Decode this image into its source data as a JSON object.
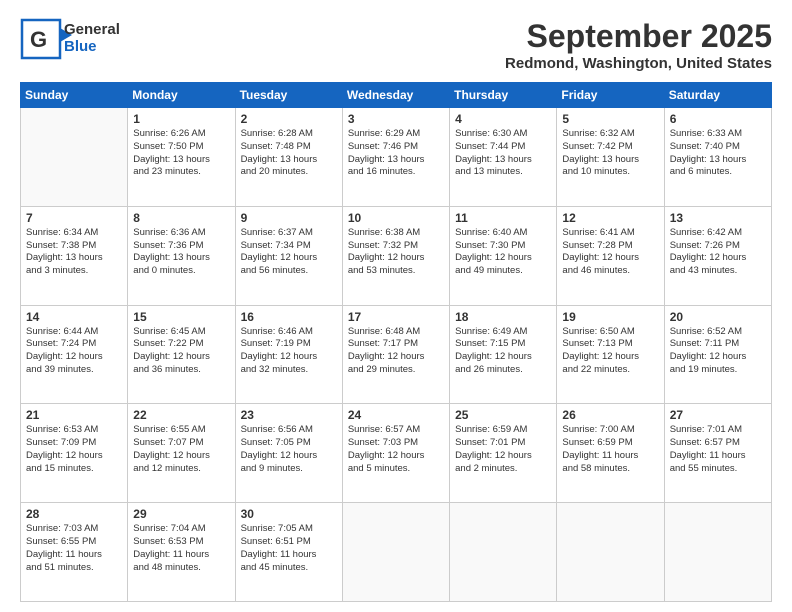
{
  "header": {
    "logo_general": "General",
    "logo_blue": "Blue",
    "month_title": "September 2025",
    "location": "Redmond, Washington, United States"
  },
  "calendar": {
    "days_of_week": [
      "Sunday",
      "Monday",
      "Tuesday",
      "Wednesday",
      "Thursday",
      "Friday",
      "Saturday"
    ],
    "weeks": [
      [
        {
          "day": "",
          "info": ""
        },
        {
          "day": "1",
          "info": "Sunrise: 6:26 AM\nSunset: 7:50 PM\nDaylight: 13 hours\nand 23 minutes."
        },
        {
          "day": "2",
          "info": "Sunrise: 6:28 AM\nSunset: 7:48 PM\nDaylight: 13 hours\nand 20 minutes."
        },
        {
          "day": "3",
          "info": "Sunrise: 6:29 AM\nSunset: 7:46 PM\nDaylight: 13 hours\nand 16 minutes."
        },
        {
          "day": "4",
          "info": "Sunrise: 6:30 AM\nSunset: 7:44 PM\nDaylight: 13 hours\nand 13 minutes."
        },
        {
          "day": "5",
          "info": "Sunrise: 6:32 AM\nSunset: 7:42 PM\nDaylight: 13 hours\nand 10 minutes."
        },
        {
          "day": "6",
          "info": "Sunrise: 6:33 AM\nSunset: 7:40 PM\nDaylight: 13 hours\nand 6 minutes."
        }
      ],
      [
        {
          "day": "7",
          "info": "Sunrise: 6:34 AM\nSunset: 7:38 PM\nDaylight: 13 hours\nand 3 minutes."
        },
        {
          "day": "8",
          "info": "Sunrise: 6:36 AM\nSunset: 7:36 PM\nDaylight: 13 hours\nand 0 minutes."
        },
        {
          "day": "9",
          "info": "Sunrise: 6:37 AM\nSunset: 7:34 PM\nDaylight: 12 hours\nand 56 minutes."
        },
        {
          "day": "10",
          "info": "Sunrise: 6:38 AM\nSunset: 7:32 PM\nDaylight: 12 hours\nand 53 minutes."
        },
        {
          "day": "11",
          "info": "Sunrise: 6:40 AM\nSunset: 7:30 PM\nDaylight: 12 hours\nand 49 minutes."
        },
        {
          "day": "12",
          "info": "Sunrise: 6:41 AM\nSunset: 7:28 PM\nDaylight: 12 hours\nand 46 minutes."
        },
        {
          "day": "13",
          "info": "Sunrise: 6:42 AM\nSunset: 7:26 PM\nDaylight: 12 hours\nand 43 minutes."
        }
      ],
      [
        {
          "day": "14",
          "info": "Sunrise: 6:44 AM\nSunset: 7:24 PM\nDaylight: 12 hours\nand 39 minutes."
        },
        {
          "day": "15",
          "info": "Sunrise: 6:45 AM\nSunset: 7:22 PM\nDaylight: 12 hours\nand 36 minutes."
        },
        {
          "day": "16",
          "info": "Sunrise: 6:46 AM\nSunset: 7:19 PM\nDaylight: 12 hours\nand 32 minutes."
        },
        {
          "day": "17",
          "info": "Sunrise: 6:48 AM\nSunset: 7:17 PM\nDaylight: 12 hours\nand 29 minutes."
        },
        {
          "day": "18",
          "info": "Sunrise: 6:49 AM\nSunset: 7:15 PM\nDaylight: 12 hours\nand 26 minutes."
        },
        {
          "day": "19",
          "info": "Sunrise: 6:50 AM\nSunset: 7:13 PM\nDaylight: 12 hours\nand 22 minutes."
        },
        {
          "day": "20",
          "info": "Sunrise: 6:52 AM\nSunset: 7:11 PM\nDaylight: 12 hours\nand 19 minutes."
        }
      ],
      [
        {
          "day": "21",
          "info": "Sunrise: 6:53 AM\nSunset: 7:09 PM\nDaylight: 12 hours\nand 15 minutes."
        },
        {
          "day": "22",
          "info": "Sunrise: 6:55 AM\nSunset: 7:07 PM\nDaylight: 12 hours\nand 12 minutes."
        },
        {
          "day": "23",
          "info": "Sunrise: 6:56 AM\nSunset: 7:05 PM\nDaylight: 12 hours\nand 9 minutes."
        },
        {
          "day": "24",
          "info": "Sunrise: 6:57 AM\nSunset: 7:03 PM\nDaylight: 12 hours\nand 5 minutes."
        },
        {
          "day": "25",
          "info": "Sunrise: 6:59 AM\nSunset: 7:01 PM\nDaylight: 12 hours\nand 2 minutes."
        },
        {
          "day": "26",
          "info": "Sunrise: 7:00 AM\nSunset: 6:59 PM\nDaylight: 11 hours\nand 58 minutes."
        },
        {
          "day": "27",
          "info": "Sunrise: 7:01 AM\nSunset: 6:57 PM\nDaylight: 11 hours\nand 55 minutes."
        }
      ],
      [
        {
          "day": "28",
          "info": "Sunrise: 7:03 AM\nSunset: 6:55 PM\nDaylight: 11 hours\nand 51 minutes."
        },
        {
          "day": "29",
          "info": "Sunrise: 7:04 AM\nSunset: 6:53 PM\nDaylight: 11 hours\nand 48 minutes."
        },
        {
          "day": "30",
          "info": "Sunrise: 7:05 AM\nSunset: 6:51 PM\nDaylight: 11 hours\nand 45 minutes."
        },
        {
          "day": "",
          "info": ""
        },
        {
          "day": "",
          "info": ""
        },
        {
          "day": "",
          "info": ""
        },
        {
          "day": "",
          "info": ""
        }
      ]
    ]
  }
}
